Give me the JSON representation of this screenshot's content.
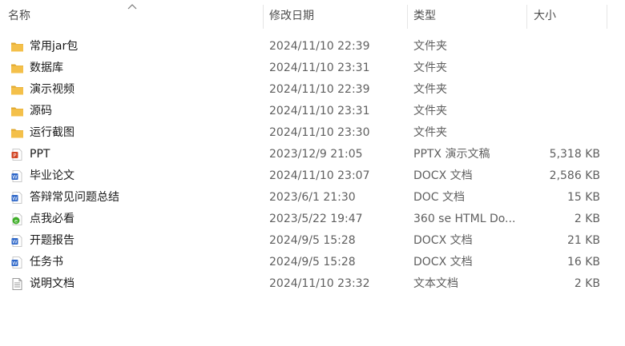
{
  "columns": {
    "name": "名称",
    "date": "修改日期",
    "type": "类型",
    "size": "大小"
  },
  "colors": {
    "folder": "#f4c04a",
    "folder_dark": "#e0a82e",
    "ppt": "#d24726",
    "word": "#2b65c8",
    "browser": "#3fae29",
    "text_file": "#9a9a9a"
  },
  "files": [
    {
      "icon": "folder-icon",
      "name": "常用jar包",
      "date": "2024/11/10 22:39",
      "type": "文件夹",
      "size": ""
    },
    {
      "icon": "folder-icon",
      "name": "数据库",
      "date": "2024/11/10 23:31",
      "type": "文件夹",
      "size": ""
    },
    {
      "icon": "folder-icon",
      "name": "演示视频",
      "date": "2024/11/10 22:39",
      "type": "文件夹",
      "size": ""
    },
    {
      "icon": "folder-icon",
      "name": "源码",
      "date": "2024/11/10 23:31",
      "type": "文件夹",
      "size": ""
    },
    {
      "icon": "folder-icon",
      "name": "运行截图",
      "date": "2024/11/10 23:30",
      "type": "文件夹",
      "size": ""
    },
    {
      "icon": "pptx-file-icon",
      "name": "PPT",
      "date": "2023/12/9 21:05",
      "type": "PPTX 演示文稿",
      "size": "5,318 KB"
    },
    {
      "icon": "docx-file-icon",
      "name": "毕业论文",
      "date": "2024/11/10 23:07",
      "type": "DOCX 文档",
      "size": "2,586 KB"
    },
    {
      "icon": "doc-file-icon",
      "name": "答辩常见问题总结",
      "date": "2023/6/1 21:30",
      "type": "DOC 文档",
      "size": "15 KB"
    },
    {
      "icon": "html-file-icon",
      "name": "点我必看",
      "date": "2023/5/22 19:47",
      "type": "360 se HTML Do...",
      "size": "2 KB"
    },
    {
      "icon": "docx-file-icon",
      "name": "开题报告",
      "date": "2024/9/5 15:28",
      "type": "DOCX 文档",
      "size": "21 KB"
    },
    {
      "icon": "docx-file-icon",
      "name": "任务书",
      "date": "2024/9/5 15:28",
      "type": "DOCX 文档",
      "size": "16 KB"
    },
    {
      "icon": "txt-file-icon",
      "name": "说明文档",
      "date": "2024/11/10 23:32",
      "type": "文本文档",
      "size": "2 KB"
    }
  ]
}
